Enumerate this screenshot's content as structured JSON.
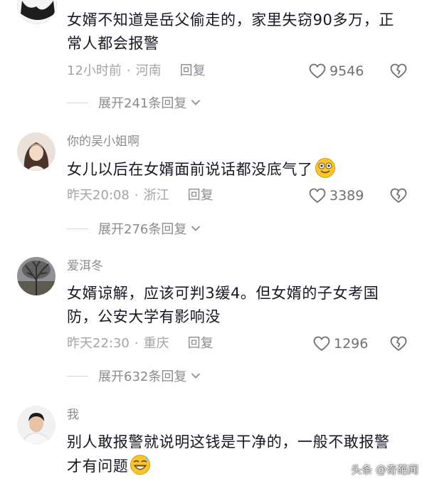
{
  "comments": [
    {
      "username": "",
      "text": "女婿不知道是岳父偷走的，家里失窃90多万，正常人都会报警",
      "time": "12小时前",
      "location": "河南",
      "reply_label": "回复",
      "likes": "9546",
      "expand_label": "展开241条回复"
    },
    {
      "username": "你的吴小姐啊",
      "text": "女儿以后在女婿面前说话都没底气了",
      "emoji": "grinning-emoji",
      "time": "昨天20:08",
      "location": "浙江",
      "reply_label": "回复",
      "likes": "3389",
      "expand_label": "展开276条回复"
    },
    {
      "username": "爱洱冬",
      "text": "女婿谅解，应该可判3缓4。但女婿的子女考国防，公安大学有影响没",
      "time": "昨天22:30",
      "location": "重庆",
      "reply_label": "回复",
      "likes": "1296",
      "expand_label": "展开632条回复"
    },
    {
      "username": "我",
      "text": "别人敢报警就说明这钱是干净的，一般不敢报警才有问题",
      "emoji": "grin-sweat-emoji"
    }
  ],
  "watermark": "头条 @奇葩闻",
  "colors": {
    "text": "#161823",
    "meta": "#a3a4a8",
    "accent_emoji": "#f7c62f"
  }
}
